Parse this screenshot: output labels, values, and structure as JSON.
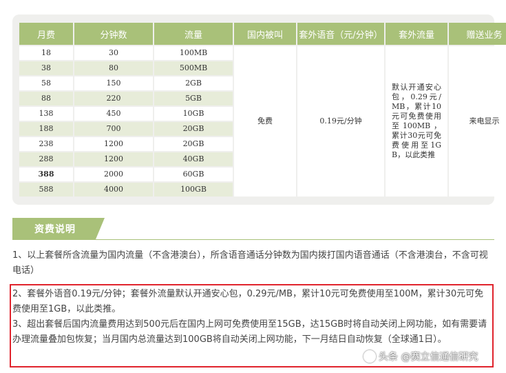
{
  "table": {
    "headers": [
      "月费",
      "分钟数",
      "流量",
      "国内被叫",
      "套外语音（元/分钟）",
      "套外流量",
      "赠送业务"
    ],
    "rows": [
      {
        "fee": "18",
        "minutes": "30",
        "data": "100MB"
      },
      {
        "fee": "38",
        "minutes": "80",
        "data": "500MB"
      },
      {
        "fee": "58",
        "minutes": "150",
        "data": "2GB"
      },
      {
        "fee": "88",
        "minutes": "220",
        "data": "5GB"
      },
      {
        "fee": "138",
        "minutes": "450",
        "data": "10GB"
      },
      {
        "fee": "188",
        "minutes": "700",
        "data": "20GB"
      },
      {
        "fee": "238",
        "minutes": "1200",
        "data": "20GB"
      },
      {
        "fee": "288",
        "minutes": "1200",
        "data": "40GB"
      },
      {
        "fee": "388",
        "minutes": "2000",
        "data": "60GB"
      },
      {
        "fee": "588",
        "minutes": "4000",
        "data": "100GB"
      }
    ],
    "incoming": "免费",
    "extra_voice": "0.19元/分钟",
    "extra_data": "默认开通安心包，0.29元/MB，累计10元可免费使用至100MB，累计30元可免费使用至1GB，以此类推",
    "bonus": "来电显示"
  },
  "section": {
    "title": "资费说明"
  },
  "notes": {
    "n1": "1、以上套餐所含流量为国内流量（不含港澳台），所含语音通话分钟数为国内拨打国内语音通话（不含港澳台，不含可视电话）",
    "n2": "2、套餐外语音0.19元/分钟；套餐外流量默认开通安心包，0.29元/MB，累计10元可免费使用至100M，累计30元可免费使用至1GB，以此类推。",
    "n3": "3、超出套餐后国内流量费用达到500元后在国内上网可免费使用至15GB，达15GB时将自动关闭上网功能，如有需要请办理流量叠加包恢复；当月国内总流量达到100GB将自动关闭上网功能，下一月结日自动恢复（全球通1日）。"
  },
  "watermark": {
    "text": "头条 @赛立信通信研究"
  }
}
